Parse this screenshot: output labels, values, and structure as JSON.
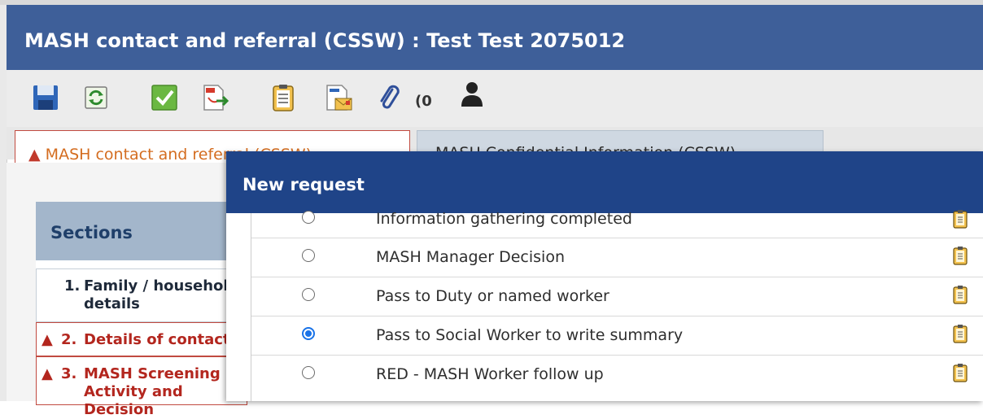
{
  "window": {
    "title": "MASH contact and referral (CSSW) : Test Test  2075012"
  },
  "toolbar": {
    "buttons": [
      {
        "icon": "save-icon"
      },
      {
        "icon": "refresh-icon"
      },
      {
        "icon": "checkmark-icon"
      },
      {
        "icon": "pdf-export-icon"
      },
      {
        "icon": "clipboard-icon"
      },
      {
        "icon": "email-form-icon"
      },
      {
        "icon": "paperclip-icon"
      },
      {
        "icon": "person-icon"
      }
    ],
    "attachment_count": "(0"
  },
  "tabs": [
    {
      "label": "MASH contact and referral (CSSW)",
      "warning": true,
      "active": true
    },
    {
      "label": "MASH Confidential Information (CSSW)",
      "active": false
    }
  ],
  "sections": {
    "title": "Sections",
    "items": [
      {
        "number": "1.",
        "label": "Family / household details",
        "error": false
      },
      {
        "number": "2.",
        "label": "Details of contact",
        "error": true
      },
      {
        "number": "3.",
        "label": "MASH Screening Activity and Decision",
        "error": true
      }
    ]
  },
  "dialog": {
    "title": "New request",
    "options": [
      {
        "label": "Information gathering completed",
        "checked": false
      },
      {
        "label": "MASH Manager Decision",
        "checked": false
      },
      {
        "label": "Pass to Duty or named worker",
        "checked": false
      },
      {
        "label": "Pass to Social Worker to write summary",
        "checked": true
      },
      {
        "label": "RED - MASH Worker follow up",
        "checked": false
      }
    ]
  },
  "colors": {
    "titlebar": "#3e5f99",
    "dialog_header": "#1f4488",
    "error_red": "#b3261e",
    "tab_warning_orange": "#d46d20",
    "radio_selected": "#1a73e8"
  }
}
